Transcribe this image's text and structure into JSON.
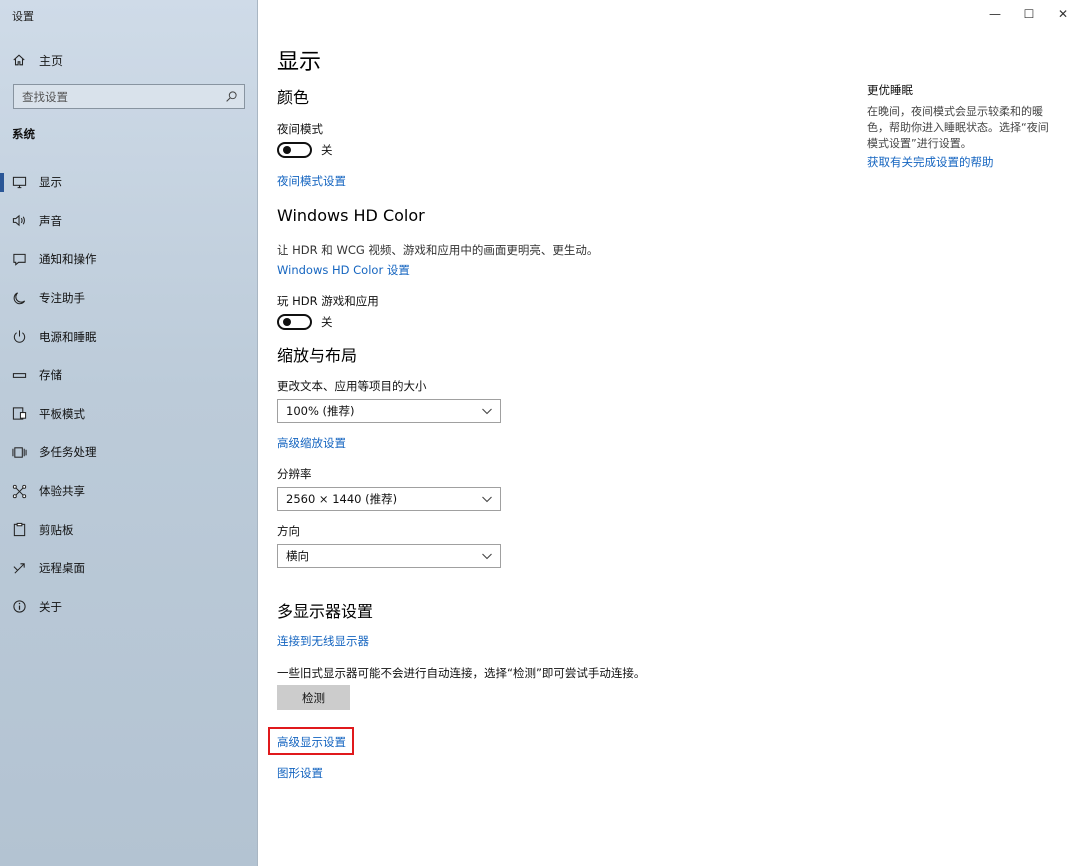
{
  "window": {
    "title": "设置",
    "controls": {
      "minimize": "—",
      "maximize": "☐",
      "close": "✕"
    }
  },
  "sidebar": {
    "home_label": "主页",
    "search_placeholder": "查找设置",
    "section_label": "系统",
    "items": [
      {
        "label": "显示",
        "icon": "monitor-icon",
        "active": true
      },
      {
        "label": "声音",
        "icon": "speaker-icon"
      },
      {
        "label": "通知和操作",
        "icon": "notification-icon"
      },
      {
        "label": "专注助手",
        "icon": "moon-icon"
      },
      {
        "label": "电源和睡眠",
        "icon": "power-icon"
      },
      {
        "label": "存储",
        "icon": "storage-icon"
      },
      {
        "label": "平板模式",
        "icon": "tablet-icon"
      },
      {
        "label": "多任务处理",
        "icon": "multitask-icon"
      },
      {
        "label": "体验共享",
        "icon": "share-icon"
      },
      {
        "label": "剪贴板",
        "icon": "clipboard-icon"
      },
      {
        "label": "远程桌面",
        "icon": "remote-icon"
      },
      {
        "label": "关于",
        "icon": "info-icon"
      }
    ]
  },
  "main": {
    "page_title": "显示",
    "color": {
      "heading": "颜色",
      "night_mode_label": "夜间模式",
      "night_mode_state": "关",
      "night_mode_link": "夜间模式设置"
    },
    "hdr": {
      "heading": "Windows HD Color",
      "description": "让 HDR 和 WCG 视频、游戏和应用中的画面更明亮、更生动。",
      "settings_link": "Windows HD Color 设置",
      "play_hdr_label": "玩 HDR 游戏和应用",
      "play_hdr_state": "关"
    },
    "scale": {
      "heading": "缩放与布局",
      "size_label": "更改文本、应用等项目的大小",
      "size_value": "100% (推荐)",
      "advanced_scale_link": "高级缩放设置",
      "resolution_label": "分辨率",
      "resolution_value": "2560 × 1440 (推荐)",
      "orientation_label": "方向",
      "orientation_value": "横向"
    },
    "multi": {
      "heading": "多显示器设置",
      "wireless_link": "连接到无线显示器",
      "detect_desc": "一些旧式显示器可能不会进行自动连接，选择“检测”即可尝试手动连接。",
      "detect_button": "检测",
      "advanced_display_link": "高级显示设置",
      "graphics_link": "图形设置"
    }
  },
  "side": {
    "title": "更优睡眠",
    "text": "在晚间，夜间模式会显示较柔和的暖色，帮助你进入睡眠状态。选择“夜间模式设置”进行设置。",
    "link": "获取有关完成设置的帮助"
  },
  "colors": {
    "accent_link": "#1565c0",
    "highlight_box": "#e0191c",
    "active_indicator": "#2b5797"
  }
}
